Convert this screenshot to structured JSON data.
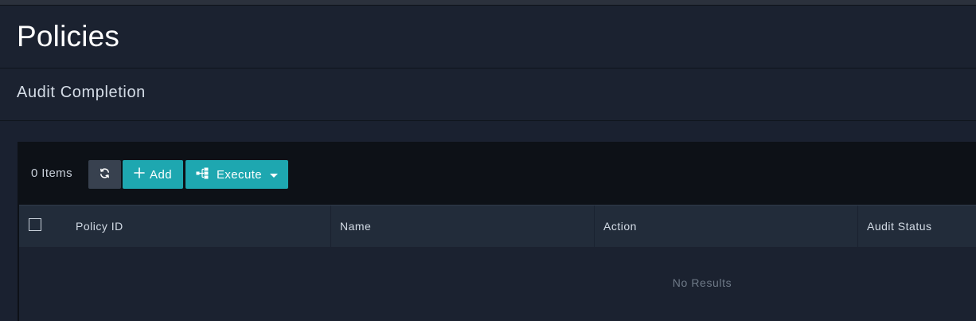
{
  "page": {
    "title": "Policies",
    "section_title": "Audit Completion"
  },
  "toolbar": {
    "items_count": "0 Items",
    "refresh_icon": "refresh-icon",
    "add_label": "Add",
    "add_icon": "plus-icon",
    "execute_label": "Execute",
    "execute_icon": "flow-icon",
    "execute_caret_icon": "caret-down-icon"
  },
  "table": {
    "columns": [
      "Policy ID",
      "Name",
      "Action",
      "Audit Status"
    ],
    "empty_message": "No Results"
  },
  "colors": {
    "background": "#1a2130",
    "panel": "#0d1117",
    "accent": "#1ea7b0",
    "header_row": "#222c3a"
  }
}
